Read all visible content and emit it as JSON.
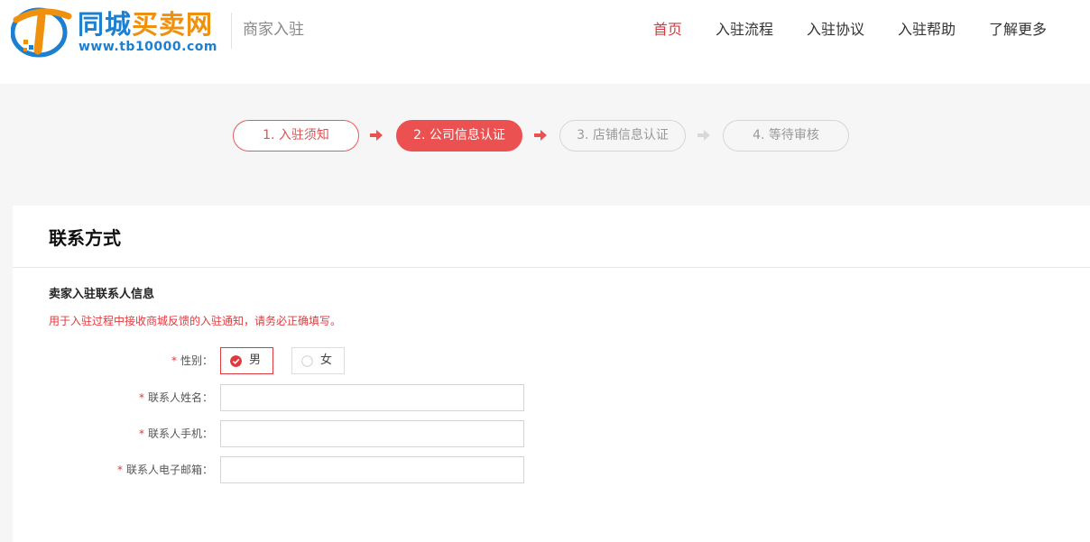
{
  "header": {
    "logo": {
      "title_part1": "同城",
      "title_part2": "买卖网",
      "url": "www.tb10000.com"
    },
    "subtitle": "商家入驻",
    "nav": [
      {
        "label": "首页",
        "active": true
      },
      {
        "label": "入驻流程",
        "active": false
      },
      {
        "label": "入驻协议",
        "active": false
      },
      {
        "label": "入驻帮助",
        "active": false
      },
      {
        "label": "了解更多",
        "active": false
      }
    ]
  },
  "steps": [
    {
      "label": "1. 入驻须知",
      "state": "done"
    },
    {
      "label": "2. 公司信息认证",
      "state": "current"
    },
    {
      "label": "3. 店铺信息认证",
      "state": "todo"
    },
    {
      "label": "4. 等待审核",
      "state": "todo"
    }
  ],
  "form": {
    "section_title": "联系方式",
    "group_title": "卖家入驻联系人信息",
    "group_note": "用于入驻过程中接收商城反馈的入驻通知，请务必正确填写。",
    "required_mark": "*",
    "gender": {
      "label": "性别：",
      "options": [
        "男",
        "女"
      ],
      "selected": "男"
    },
    "contact_name": {
      "label": "联系人姓名：",
      "value": "",
      "placeholder": ""
    },
    "contact_phone": {
      "label": "联系人手机：",
      "value": "",
      "placeholder": ""
    },
    "contact_email": {
      "label": "联系人电子邮箱：",
      "value": "",
      "placeholder": ""
    }
  },
  "colors": {
    "accent": "#ec5152",
    "brand_blue": "#1c7fd0",
    "brand_orange": "#f0900f",
    "step_pending_arrow": "#d8d8d8"
  }
}
